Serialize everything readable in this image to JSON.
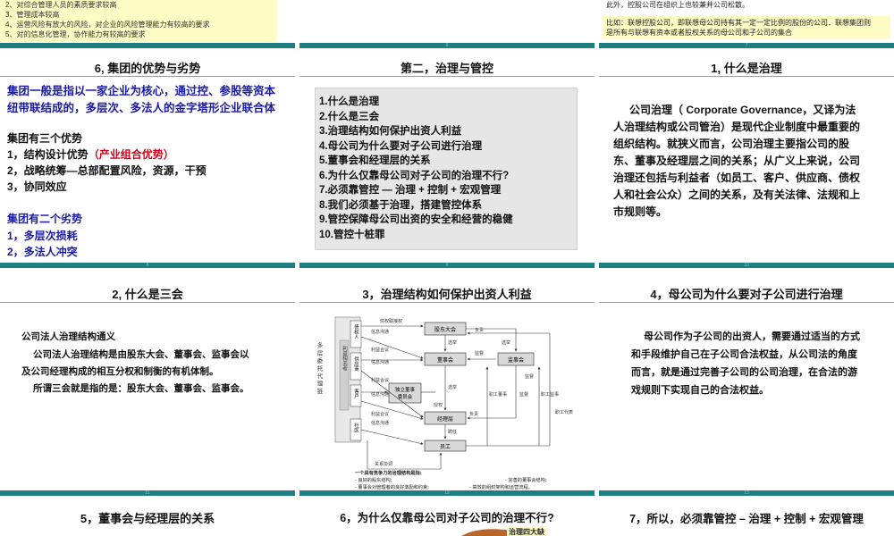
{
  "top": {
    "left_items": [
      "2、对综合管理人员的素质要求较高",
      "3、管理成本较高",
      "4、运营风险有放大的风险，对企业的风险管理能力有较高的要求",
      "5、对的信息化管理，协作能力有较高的要求"
    ],
    "right_line1": "此外，控股公司在组织上也较兼并公司松散。",
    "right_line2": "比如：联想控股公司，即联想母公司持有其一定一定比例的股份的公司．联想集团则",
    "right_line3": "是所有与联想有资本或者股权关系的母公司和子公司的集合",
    "nums": [
      "6",
      "7"
    ]
  },
  "s6": {
    "title": "6, 集团的优势与劣势",
    "def1": "集团一般是指以一家企业为核心，通过控、参股等资本",
    "def2": "纽带联结成的，多层次、多法人的金字塔形企业联合体",
    "adv_head": "集团有三个优势",
    "adv1a": "1，结构设计优势",
    "adv1b": "（产业组合优势）",
    "adv2": "2，战略统筹—总部配置风险，资源，干预",
    "adv3": "3，协同效应",
    "dis_head": "集团有二个劣势",
    "dis1": "1，多层次损耗",
    "dis2": "2，多法人冲突",
    "num": "8"
  },
  "s9": {
    "title": "第二，治理与管控",
    "items": [
      "1.什么是治理",
      "2.什么是三会",
      "3.治理结构如何保护出资人利益",
      "4.母公司为什么要对子公司进行治理",
      "5.董事会和经理层的关系",
      "6.为什么仅靠母公司对子公司的治理不行?",
      "7.必须靠管控 — 治理 + 控制 + 宏观管理",
      "8.我们必须基于治理，搭建管控体系",
      "9.管控保障母公司出资的安全和经营的稳健",
      "10.管控十桩罪"
    ],
    "num": "9"
  },
  "s10": {
    "title": "1, 什么是治理",
    "lines": [
      "公司治理（ Corporate Governance，又译为法",
      "人治理结构或公司管治）是现代企业制度中最重要的",
      "组织结构。就狭义而言，公司治理主要指公司的股",
      "东、董事及经理层之间的关系；从广义上来说，公司",
      "治理还包括与利益者（如员工、客户、供应商、债权",
      "人和社会公众）之间的关系，及有关法律、法规和上",
      "市规则等。"
    ],
    "num": "10"
  },
  "s11": {
    "title": "2, 什么是三会",
    "head": "公司法人治理结构通义",
    "lines": [
      "公司法人治理结构是由股东大会、董事会、监事会以",
      "及公司经理构成的相互分权和制衡的有机体制。",
      "所谓三会就是指的是：股东大会、董事会、监事会。"
    ],
    "num": "11"
  },
  "s12": {
    "title": "3，治理结构如何保护出资人利益",
    "side_label": "多 层 委 托 代 理 链",
    "stakeholders": [
      "债权人",
      "供应商",
      "客户",
      "社区"
    ],
    "inner_label": "利益相关者",
    "boxes": [
      "股东大会",
      "董事会",
      "监事会",
      "经理层",
      "员工",
      "独立董事\n委员会"
    ],
    "edge_labels": [
      "债权联接权",
      "信息沟通",
      "利益合议",
      "信息沟通",
      "利益合议",
      "信息沟通",
      "利益合议",
      "信息沟通",
      "关系协调",
      "选举",
      "选举",
      "监督",
      "监督",
      "选举",
      "授权",
      "负责",
      "负责",
      "监督",
      "职工董事",
      "职工监事",
      "职工代表",
      "聘任"
    ],
    "notes": [
      "一个具有竞争力的治理结构是指:",
      "- 良好的股东结构;",
      "- 完善的董事会结构;",
      "- 董事会对管理者的良好激励和约束;",
      "- 高效的组织架构和运营流程。"
    ],
    "num": "12"
  },
  "s13": {
    "title": "4，母公司为什么要对子公司进行治理",
    "lines": [
      "母公司作为子公司的出资人，需要通过适当的方式",
      "和手段维护自己在子公司合法权益，从公司法的角度",
      "而言，就是通过完善子公司的公司治理，在合法的游",
      "戏规则下实现自己的合法权益。"
    ],
    "num": "13"
  },
  "bottom": {
    "t14": "5，董事会与经理层的关系",
    "t15": "6，为什么仅靠母公司对子公司的治理不行?",
    "t15_badge": "治理四大缺",
    "t16": "7，所以，必须靠管控 – 治理 + 控制 + 宏观管理"
  },
  "colors": {
    "accent": "#1e7f83",
    "blue": "#1a1aa8",
    "red": "#d9001a",
    "yellow": "#fdfcc4"
  }
}
